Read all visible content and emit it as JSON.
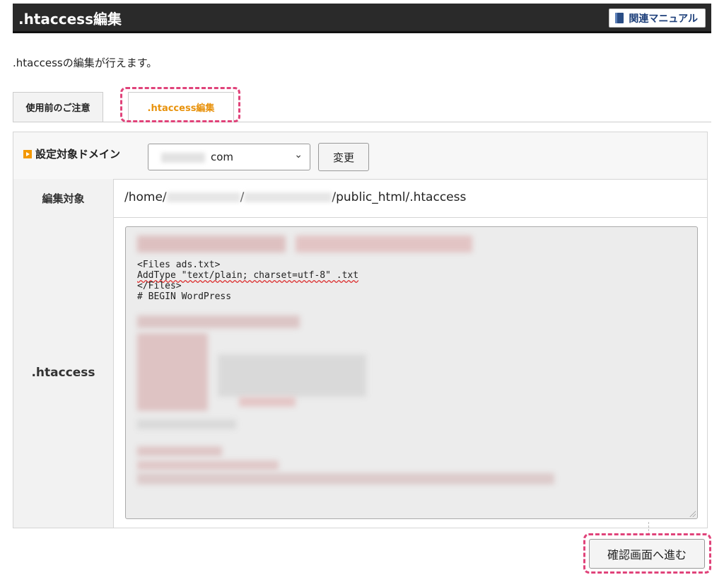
{
  "header": {
    "title": ".htaccess編集",
    "manual_button": "関連マニュアル"
  },
  "description": ".htaccessの編集が行えます。",
  "tabs": [
    {
      "label": "使用前のご注意",
      "active": false
    },
    {
      "label": ".htaccess編集",
      "active": true
    }
  ],
  "domain_row": {
    "label": "設定対象ドメイン",
    "selected_value": "com",
    "change_button": "変更"
  },
  "target_row": {
    "label": "編集対象",
    "path_prefix": "/home/",
    "path_sep": "/",
    "path_suffix": "/public_html/.htaccess"
  },
  "htaccess_row": {
    "label": ".htaccess",
    "code_lines": [
      "<Files ads.txt>",
      "AddType \"text/plain; charset=utf-8\" .txt",
      "</Files>",
      "# BEGIN WordPress"
    ]
  },
  "footer": {
    "confirm_button": "確認画面へ進む"
  },
  "colors": {
    "titlebar": "#2a2a2a",
    "active_tab_text": "#e8920c",
    "highlight": "#e0437a",
    "label_bg": "#f2f2f2"
  }
}
